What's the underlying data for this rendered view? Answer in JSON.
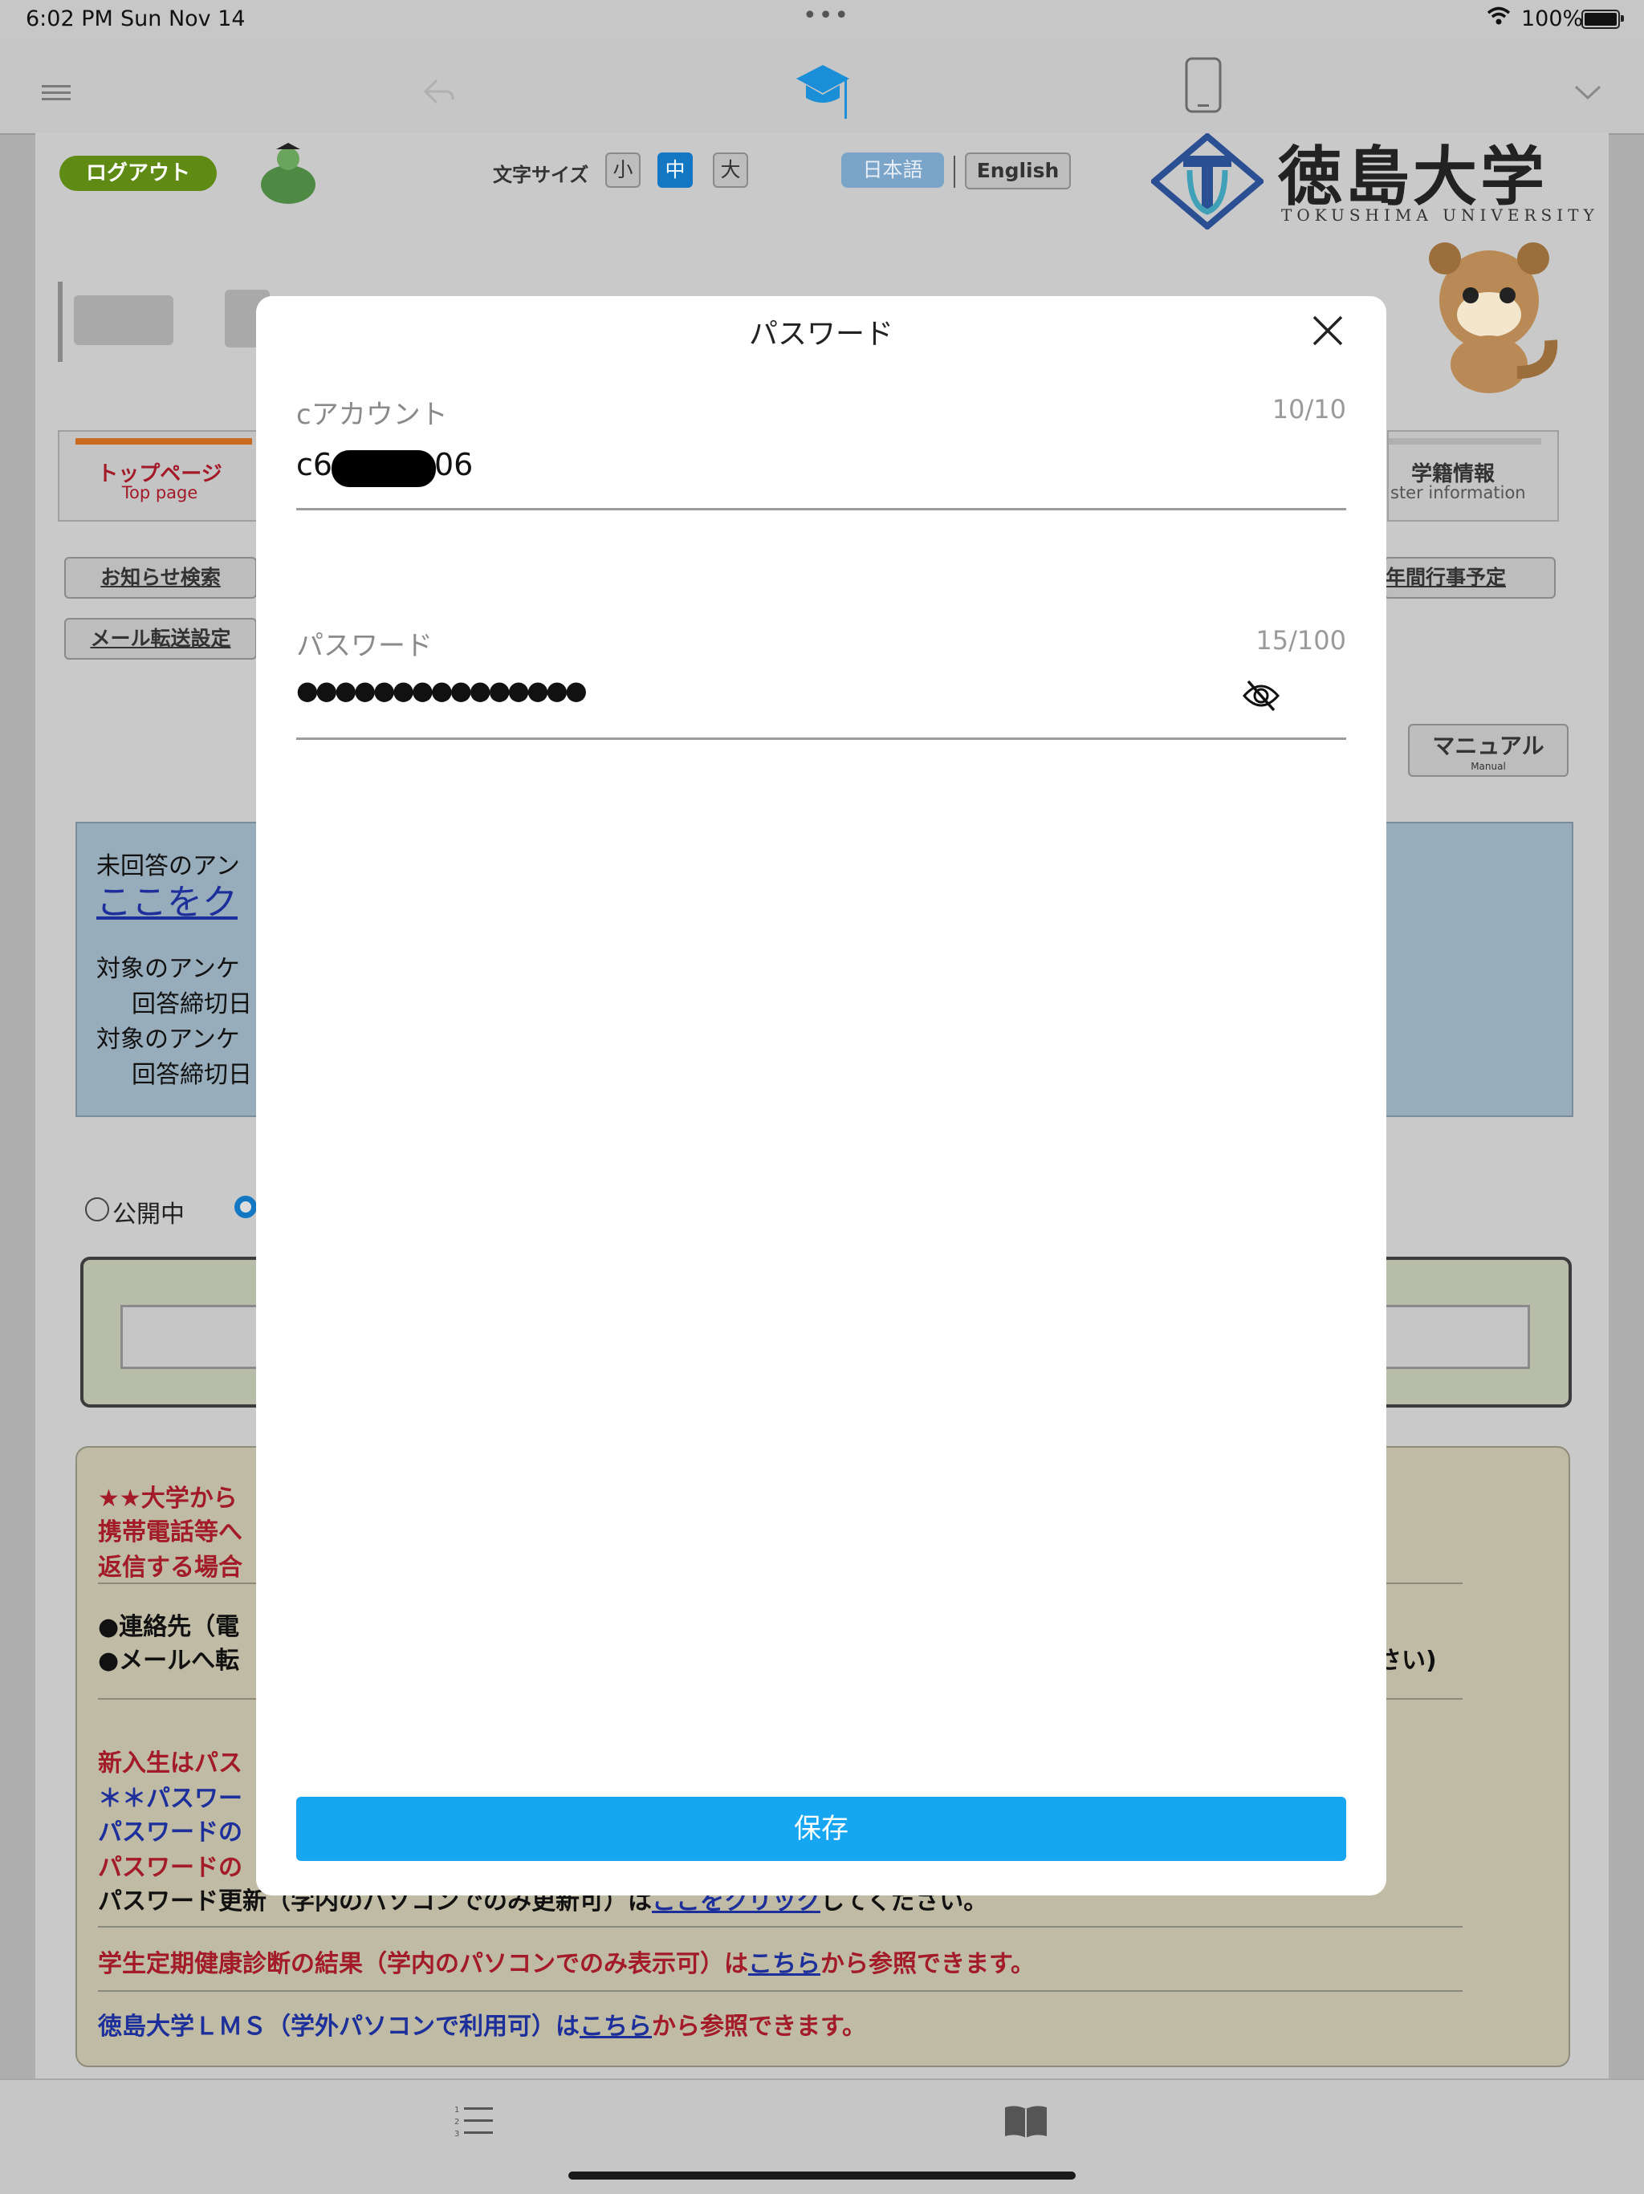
{
  "status_bar": {
    "time": "6:02 PM",
    "date": "Sun Nov 14",
    "dots": "•••",
    "battery": "100%"
  },
  "toolbar": {
    "icons": [
      "menu-icon",
      "back-arrow-icon",
      "graduation-cap-icon",
      "phone-icon",
      "chevron-down-icon"
    ]
  },
  "header": {
    "logout": "ログアウト",
    "font_size_label": "文字サイズ",
    "size_small": "小",
    "size_medium": "中",
    "size_large": "大",
    "lang_ja": "日本語",
    "lang_en": "English",
    "university_name": "徳島大学",
    "university_name_en": "TOKUSHIMA UNIVERSITY"
  },
  "nav": {
    "top_page": "トップページ",
    "top_page_en": "Top page",
    "register": "学籍情報",
    "register_en": "ster information",
    "notice_search": "お知らせ検索",
    "mail_forward": "メール転送設定",
    "annual_events": "年間行事予定",
    "manual": "マニュアル",
    "manual_en": "Manual"
  },
  "survey_box": {
    "line1": "未回答のアン",
    "link": "ここをク",
    "line3": "対象のアンケ",
    "line4": "回答締切日",
    "line5": "対象のアンケ",
    "line6": "回答締切日"
  },
  "filters": {
    "public": "公開中"
  },
  "notices": {
    "n1": "★★大学から",
    "n2": "携帯電話等へ",
    "n3": "返信する場合",
    "n4": "●連絡先（電",
    "n5": "●メールへ転",
    "n5_tail": "さい)",
    "n6": "新入生はパス",
    "n7": "＊＊パスワー",
    "n8": "パスワードの",
    "n9": "パスワードの",
    "n10_pre": "パスワード更新（学内のパソコンでのみ更新可）は",
    "n10_link": "ここをクリック",
    "n10_post": "してください。",
    "n11_pre": "学生定期健康診断の結果（学内のパソコンでのみ表示可）は",
    "n11_link": "こちら",
    "n11_post": "から参照できます。",
    "n12_pre": "徳島大学ＬＭＳ（学外パソコンで利用可）は",
    "n12_link": "こちら",
    "n12_post": "から参照できます。"
  },
  "modal": {
    "title": "パスワード",
    "account_label": "cアカウント",
    "account_counter": "10/10",
    "account_prefix": "c6",
    "account_suffix": "06",
    "password_label": "パスワード",
    "password_counter": "15/100",
    "password_value": "●●●●●●●●●●●●●●●",
    "save_label": "保存",
    "close_icon": "close-icon",
    "visibility_icon": "eye-off-icon"
  },
  "bottom_bar": {
    "icons": [
      "numbered-list-icon",
      "book-icon"
    ]
  }
}
